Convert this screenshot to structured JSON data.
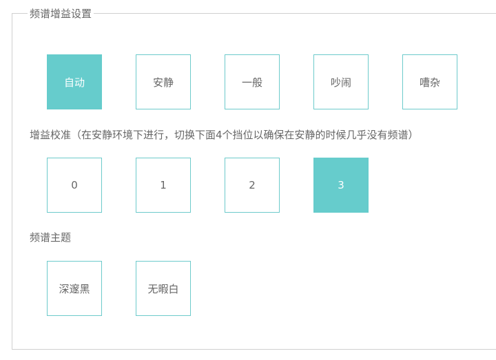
{
  "panel": {
    "title": "频谱增益设置"
  },
  "gain_mode": {
    "options": [
      {
        "label": "自动",
        "selected": true
      },
      {
        "label": "安静",
        "selected": false
      },
      {
        "label": "一般",
        "selected": false
      },
      {
        "label": "吵闹",
        "selected": false
      },
      {
        "label": "嘈杂",
        "selected": false
      }
    ]
  },
  "calibration": {
    "label": "增益校准（在安静环境下进行，切换下面4个挡位以确保在安静的时候几乎没有频谱）",
    "options": [
      {
        "label": "0",
        "selected": false
      },
      {
        "label": "1",
        "selected": false
      },
      {
        "label": "2",
        "selected": false
      },
      {
        "label": "3",
        "selected": true
      }
    ]
  },
  "theme": {
    "label": "频谱主题",
    "options": [
      {
        "label": "深邃黑",
        "selected": false
      },
      {
        "label": "无暇白",
        "selected": false
      }
    ]
  },
  "colors": {
    "accent": "#66cccc",
    "border": "#cfcfcf",
    "text": "#666666"
  }
}
